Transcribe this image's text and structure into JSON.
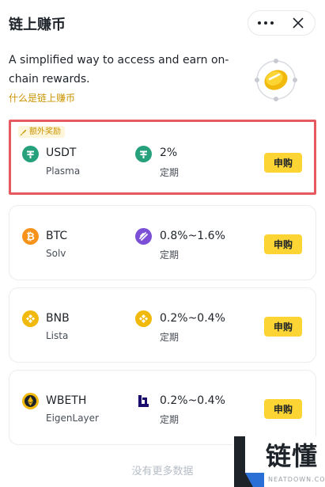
{
  "header": {
    "title": "链上赚币"
  },
  "intro": {
    "description": "A simplified way to access and earn on-chain rewards.",
    "link": "什么是链上赚币"
  },
  "products": [
    {
      "bonus_tag": "额外奖励",
      "asset": "USDT",
      "network": "Plasma",
      "rate": "2%",
      "term": "定期",
      "button": "申购",
      "asset_icon": "tether-icon",
      "protocol_icon": "tether-icon"
    },
    {
      "asset": "BTC",
      "network": "Solv",
      "rate": "0.8%~1.6%",
      "term": "定期",
      "button": "申购",
      "asset_icon": "bitcoin-icon",
      "protocol_icon": "solv-icon"
    },
    {
      "asset": "BNB",
      "network": "Lista",
      "rate": "0.2%~0.4%",
      "term": "定期",
      "button": "申购",
      "asset_icon": "bnb-icon",
      "protocol_icon": "bnb-icon"
    },
    {
      "asset": "WBETH",
      "network": "EigenLayer",
      "rate": "0.2%~0.4%",
      "term": "定期",
      "button": "申购",
      "asset_icon": "wbeth-icon",
      "protocol_icon": "eigenlayer-icon"
    }
  ],
  "footer": {
    "text": "没有更多数据"
  },
  "watermark": {
    "text": "链懂",
    "sub": "NEATDOWN.COM"
  },
  "colors": {
    "accent": "#fcd535",
    "link": "#c99400",
    "highlight": "#e65a5f",
    "tether": "#26a17b",
    "bitcoin": "#f7931a",
    "bnb": "#f0b90b",
    "solv": "#7b4fd6"
  }
}
